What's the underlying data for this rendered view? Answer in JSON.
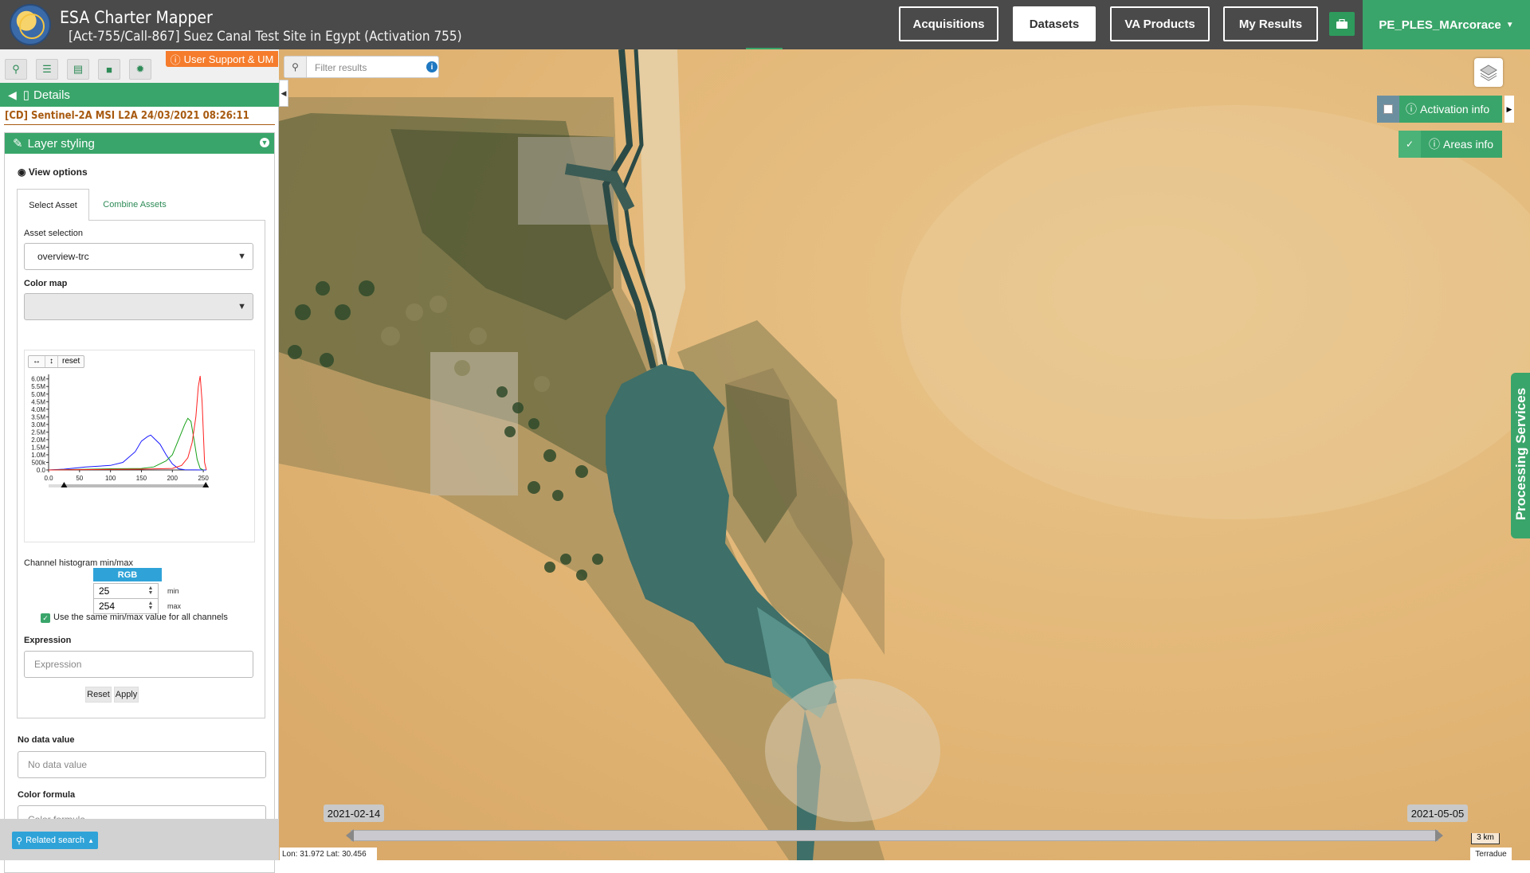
{
  "header": {
    "app_title": "ESA Charter Mapper",
    "activation_title": "[Act-755/Call-867] Suez Canal Test Site in Egypt (Activation 755)",
    "nav": [
      "Acquisitions",
      "Datasets",
      "VA Products",
      "My Results"
    ],
    "active_nav": "Datasets",
    "user": "PE_PLES_MArcorace",
    "briefcase_icon": "briefcase-icon"
  },
  "left_panel": {
    "support_label": "User Support & UM",
    "details_label": "Details",
    "product": "[CD] Sentinel-2A MSI L2A 24/03/2021 08:26:11",
    "layer_styling": "Layer styling",
    "view_options": "View options",
    "tabs": [
      "Select Asset",
      "Combine Assets"
    ],
    "asset_selection_label": "Asset selection",
    "asset_selection_value": "overview-trc",
    "color_map_label": "Color map",
    "color_map_value": "",
    "histogram_buttons": [
      "reset"
    ],
    "channel_label": "Channel histogram min/max",
    "channel_badge": "RGB",
    "min_value": "25",
    "max_value": "254",
    "min_label": "min",
    "max_label": "max",
    "same_minmax_label": "Use the same min/max value for all channels",
    "expression_label": "Expression",
    "expression_placeholder": "Expression",
    "reset_label": "Reset",
    "apply_label": "Apply",
    "nodata_label": "No data value",
    "nodata_placeholder": "No data value",
    "color_formula_label": "Color formula",
    "color_formula_placeholder": "Color formula",
    "related_search": "Related search"
  },
  "chart_data": {
    "type": "line",
    "x_ticks": [
      "0.0",
      "50",
      "100",
      "150",
      "200",
      "250"
    ],
    "y_ticks": [
      "0.0",
      "500k",
      "1.0M",
      "1.5M",
      "2.0M",
      "2.5M",
      "3.0M",
      "3.5M",
      "4.0M",
      "4.5M",
      "5.0M",
      "5.5M",
      "6.0M"
    ],
    "xlim": [
      0,
      255
    ],
    "ylim": [
      0,
      6300000
    ],
    "series": [
      {
        "color": "#1a1aff",
        "x": [
          0,
          25,
          60,
          100,
          120,
          140,
          150,
          160,
          165,
          170,
          180,
          190,
          200,
          210,
          220,
          255
        ],
        "y": [
          0,
          50000,
          200000,
          300000,
          500000,
          1200000,
          1900000,
          2200000,
          2300000,
          2100000,
          1700000,
          1000000,
          400000,
          80000,
          10000,
          0
        ]
      },
      {
        "color": "#18a018",
        "x": [
          0,
          100,
          150,
          170,
          190,
          200,
          210,
          220,
          225,
          230,
          235,
          240,
          245,
          250
        ],
        "y": [
          0,
          80000,
          100000,
          200000,
          600000,
          1000000,
          2000000,
          3000000,
          3400000,
          3200000,
          2000000,
          700000,
          100000,
          0
        ]
      },
      {
        "color": "#ff2020",
        "x": [
          0,
          150,
          200,
          215,
          225,
          232,
          238,
          242,
          245,
          248,
          252,
          255
        ],
        "y": [
          0,
          50000,
          100000,
          300000,
          800000,
          1800000,
          3500000,
          5500000,
          6200000,
          4500000,
          500000,
          0
        ]
      }
    ],
    "slider_range": [
      25,
      254
    ]
  },
  "map": {
    "filter_placeholder": "Filter results",
    "activation_info": "Activation info",
    "areas_info": "Areas info",
    "processing_services": "Processing Services",
    "date_start": "2021-02-14",
    "date_end": "2021-05-05",
    "scale": "3 km",
    "coords": "Lon: 31.972 Lat: 30.456",
    "attribution": "Terradue"
  },
  "colors": {
    "accent_green": "#3aa56a",
    "header_grey": "#4a4a4a",
    "support_orange": "#f57c2c",
    "info_blue": "#2fa3d8"
  }
}
